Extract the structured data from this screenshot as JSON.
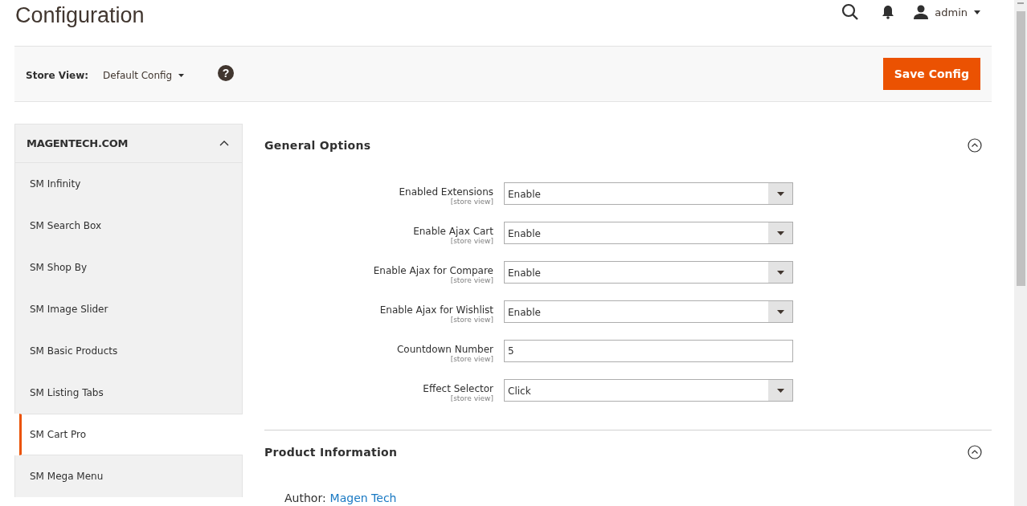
{
  "page": {
    "title": "Configuration"
  },
  "header": {
    "user": "admin"
  },
  "store_bar": {
    "label": "Store View:",
    "value": "Default Config",
    "help_icon": "?",
    "save_button": "Save Config"
  },
  "sidebar": {
    "group": {
      "title": "MAGENTECH.COM",
      "expanded": true
    },
    "items": [
      {
        "label": "SM Infinity",
        "selected": false
      },
      {
        "label": "SM Search Box",
        "selected": false
      },
      {
        "label": "SM Shop By",
        "selected": false
      },
      {
        "label": "SM Image Slider",
        "selected": false
      },
      {
        "label": "SM Basic Products",
        "selected": false
      },
      {
        "label": "SM Listing Tabs",
        "selected": false
      },
      {
        "label": "SM Cart Pro",
        "selected": true
      },
      {
        "label": "SM Mega Menu",
        "selected": false
      }
    ]
  },
  "sections": [
    {
      "title": "General Options",
      "expanded": true,
      "fields": [
        {
          "kind": "select",
          "label": "Enabled Extensions",
          "scope": "[store view]",
          "value": "Enable"
        },
        {
          "kind": "select",
          "label": "Enable Ajax Cart",
          "scope": "[store view]",
          "value": "Enable"
        },
        {
          "kind": "select",
          "label": "Enable Ajax for Compare",
          "scope": "[store view]",
          "value": "Enable"
        },
        {
          "kind": "select",
          "label": "Enable Ajax for Wishlist",
          "scope": "[store view]",
          "value": "Enable"
        },
        {
          "kind": "text",
          "label": "Countdown Number",
          "scope": "[store view]",
          "value": "5"
        },
        {
          "kind": "select",
          "label": "Effect Selector",
          "scope": "[store view]",
          "value": "Click"
        }
      ]
    },
    {
      "title": "Product Information",
      "expanded": true,
      "author_label": "Author:",
      "author_link": "Magen Tech"
    }
  ]
}
